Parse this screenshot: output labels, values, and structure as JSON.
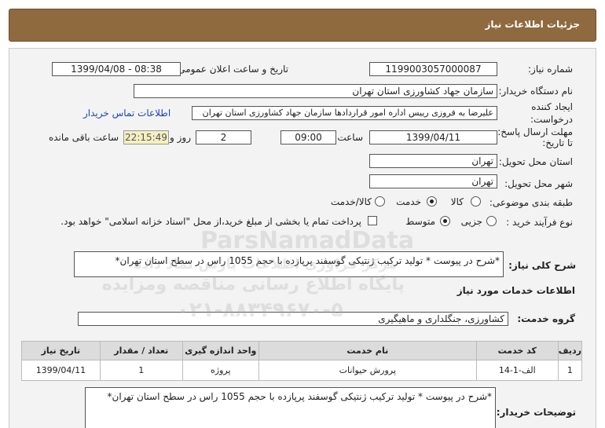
{
  "header": {
    "title": "جزئیات اطلاعات نیاز"
  },
  "fields": {
    "need_number_label": "شماره نیاز:",
    "need_number": "1199003057000087",
    "announce_label": "تاریخ و ساعت اعلان عمومی:",
    "announce_value": "1399/04/08 - 08:38",
    "buyer_org_label": "نام دستگاه خریدار:",
    "buyer_org": "سازمان جهاد کشاورزی استان تهران",
    "requester_label_1": "ایجاد کننده",
    "requester_label_2": "درخواست:",
    "requester": "علیرضا به فروزی رییس اداره امور قراردادها سازمان جهاد کشاورزی استان تهران",
    "contact_link": "اطلاعات تماس خریدار",
    "deadline_label_1": "مهلت ارسال پاسخ:",
    "deadline_label_2": "تا تاریخ:",
    "deadline_date": "1399/04/11",
    "time_label": "ساعت",
    "deadline_time": "09:00",
    "days_value": "2",
    "days_label": "روز و",
    "remaining_time": "22:15:49",
    "remaining_label": "ساعت باقی مانده",
    "province_label": "استان محل تحویل:",
    "province": "تهران",
    "city_label": "شهر محل تحویل:",
    "city": "تهران",
    "category_label": "طبقه بندی موضوعی:",
    "category_options": [
      "کالا",
      "خدمت",
      "کالا/خدمت"
    ],
    "category_selected": "خدمت",
    "process_label": "نوع فرآیند خرید :",
    "process_options": [
      "جزیی",
      "متوسط"
    ],
    "process_selected": "متوسط",
    "payment_note": "پرداخت تمام یا بخشی از مبلغ خرید،از محل \"اسناد خزانه اسلامی\" خواهد بود."
  },
  "summary": {
    "label": "شرح کلی نیاز:",
    "text": "*شرح در پیوست * تولید ترکیب ژنتیکی گوسفند پرپازده با حجم 1055 راس در سطح استان تهران*"
  },
  "services": {
    "section_title": "اطلاعات خدمات مورد نیاز",
    "group_label": "گروه خدمت:",
    "group_value": "کشاورزی، جنگلداری و ماهیگیری",
    "columns": [
      "ردیف",
      "کد خدمت",
      "نام خدمت",
      "واحد اندازه گیری",
      "تعداد / مقدار",
      "تاریخ نیاز"
    ],
    "rows": [
      [
        "1",
        "الف-1-14",
        "پرورش حیوانات",
        "پروژه",
        "1",
        "1399/04/11"
      ]
    ]
  },
  "buyer_notes": {
    "label": "توضیحات خریدار:",
    "text": "*شرح در پیوست * تولید ترکیب ژنتیکی گوسفند پرپازده با حجم 1055 راس در سطح استان تهران*"
  },
  "watermark": {
    "brand": "ParsNamadData",
    "line1": "مرکز فراوری اطلاعات پارس نماد داده",
    "line2": "پایگاه اطلاع رسانی مناقصه ومزایده",
    "phone": "۰۲۱-۸۸۳۴۹۶۷۰-۵"
  }
}
